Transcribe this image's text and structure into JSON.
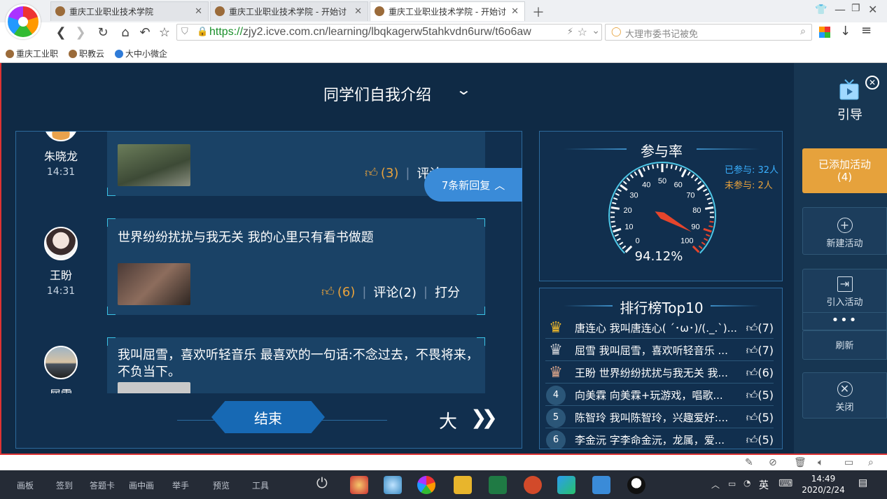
{
  "browser": {
    "tabs": [
      {
        "title": "重庆工业职业技术学院"
      },
      {
        "title": "重庆工业职业技术学院 - 开始讨"
      },
      {
        "title": "重庆工业职业技术学院 - 开始讨"
      }
    ],
    "url_protocol": "https://",
    "url_rest": "zjy2.icve.com.cn/learning/lbqkagerw5tahkvdn6urw/t6o6aw",
    "search_placeholder": "大理市委书记被免",
    "bookmarks": [
      "重庆工业职",
      "职教云",
      "大中小微企"
    ]
  },
  "page": {
    "title": "同学们自我介绍"
  },
  "feed": {
    "new_replies": "7条新回复",
    "end_button": "结束",
    "posts": [
      {
        "name": "朱晓龙",
        "time": "14:31",
        "text": "",
        "likes": "(3)",
        "comments": "评论(1)",
        "score": ""
      },
      {
        "name": "王盼",
        "time": "14:31",
        "text": "世界纷纷扰扰与我无关 我的心里只有看书做题",
        "likes": "(6)",
        "comments": "评论(2)",
        "score": "打分"
      },
      {
        "name": "屈雪",
        "time": "",
        "text": "我叫屈雪，喜欢听轻音乐 最喜欢的一句话:不念过去，不畏将来，不负当下。",
        "likes": "",
        "comments": "",
        "score": ""
      }
    ]
  },
  "participation": {
    "title": "参与率",
    "joined": "已参与: 32人",
    "not_joined": "未参与: 2人",
    "percent_label": "94.12%",
    "rate": 94.12,
    "ticks": [
      "0",
      "10",
      "20",
      "30",
      "40",
      "50",
      "60",
      "70",
      "80",
      "90",
      "100"
    ]
  },
  "ranking": {
    "title": "排行榜Top10",
    "rows": [
      {
        "rank": "1",
        "text": "唐连心 我叫唐连心( ´･ω･)/(._.`)...",
        "likes": "(7)"
      },
      {
        "rank": "2",
        "text": "屈雪 我叫屈雪，喜欢听轻音乐 ...",
        "likes": "(7)"
      },
      {
        "rank": "3",
        "text": "王盼 世界纷纷扰扰与我无关 我...",
        "likes": "(6)"
      },
      {
        "rank": "4",
        "text": "向美霖 向美霖+玩游戏，唱歌...",
        "likes": "(5)"
      },
      {
        "rank": "5",
        "text": "陈智玲 我叫陈智玲，兴趣爱好:...",
        "likes": "(5)"
      },
      {
        "rank": "6",
        "text": "李金沅 字李命金沅，龙属，爱...",
        "likes": "(5)"
      }
    ]
  },
  "sidebar": {
    "guide": "引导",
    "added_title": "已添加活动",
    "added_count": "(4)",
    "new_activity": "新建活动",
    "import_activity": "引入活动",
    "refresh": "刷新",
    "close": "关闭"
  },
  "taskbar": {
    "tools": [
      "画板",
      "签到",
      "答题卡",
      "画中画",
      "举手",
      "预览",
      "工具"
    ],
    "lang": "英",
    "time": "14:49",
    "date": "2020/2/24"
  },
  "colors": {
    "bg": "#0f2a45",
    "accent": "#3a8bd8",
    "orange": "#e6a23c",
    "frame_red": "#dd3333"
  }
}
